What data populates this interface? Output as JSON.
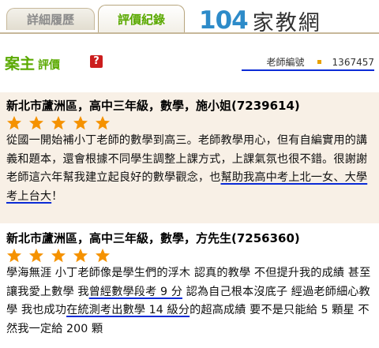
{
  "tabs": [
    {
      "label": "詳細履歷",
      "active": false
    },
    {
      "label": "評價紀錄",
      "active": true
    }
  ],
  "logo": {
    "number_before": "1",
    "number_highlight": "0",
    "number_after": "4",
    "text": "家教網"
  },
  "section": {
    "title": "案主",
    "subtitle": "評價",
    "help_icon": "?",
    "teacher_id_label": "老師編號",
    "teacher_id_value": "1367457"
  },
  "reviews": [
    {
      "title": "新北市蘆洲區，高中三年級，數學，施小姐(7239614)",
      "stars": 5,
      "text_before": "從國一開始補小丁老師的數學到高三。老師教學用心，但有自編實用的講義和題本，還會根據不同學生調整上課方式，上課氣氛也很不錯。很謝謝老師這六年幫我建立起良好的數學觀念，也",
      "text_highlight": "幫助我高中考上北一女、大學考上台大",
      "text_after": "！"
    },
    {
      "title": "新北市蘆洲區，高中三年級，數學，方先生(7256360)",
      "stars": 5,
      "text_part1": "學海無涯  小丁老師像是學生們的浮木  認真的教學  不但提升我的成績  甚至讓我愛上數學  我",
      "text_highlight1": "曾經數學段考 9 分",
      "text_part2": "  認為自己根本沒底子  經過老師細心教學  我也成功",
      "text_highlight2": "在統測考出數學 14 級分",
      "text_part3": "的超高成績  要不是只能給 5 顆星  不然我一定給 200 顆"
    }
  ],
  "colors": {
    "accent_green": "#5aa900",
    "star_orange": "#f59200",
    "underline_blue": "#0b2bd6",
    "card_bg": "#f8f0e6"
  }
}
